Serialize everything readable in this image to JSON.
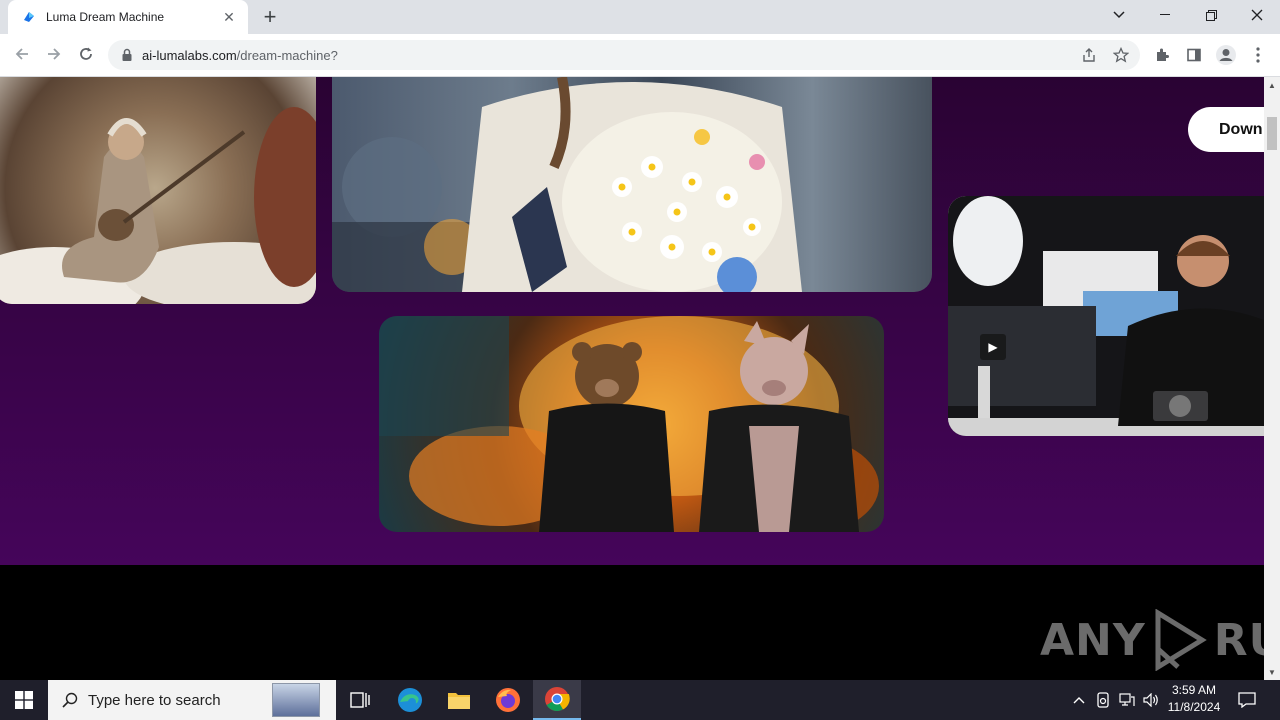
{
  "browser": {
    "tab_title": "Luma Dream Machine",
    "url_host": "ai-lumalabs.com",
    "url_path": "/dream-machine?"
  },
  "page": {
    "download_label": "Down",
    "colors": {
      "background_purple": "#45055a",
      "footer": "#000000"
    },
    "images": [
      {
        "name": "old-sage-with-banjo",
        "kind": "video-still"
      },
      {
        "name": "woman-with-flower-bouquet",
        "kind": "video-still"
      },
      {
        "name": "bear-and-pig-in-leather-jackets",
        "kind": "video-still"
      },
      {
        "name": "man-with-camera-in-studio",
        "kind": "video-still"
      }
    ]
  },
  "watermark": {
    "text_left": "ANY",
    "text_right": "RUN"
  },
  "taskbar": {
    "search_placeholder": "Type here to search",
    "time": "3:59 AM",
    "date": "11/8/2024"
  }
}
